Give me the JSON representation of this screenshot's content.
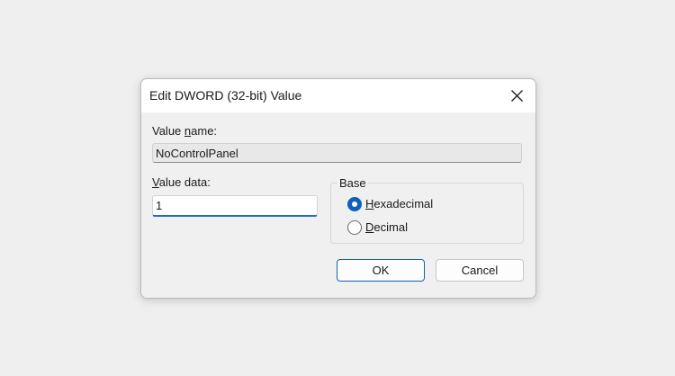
{
  "dialog": {
    "title": "Edit DWORD (32-bit) Value",
    "close_icon": "close-icon"
  },
  "value_name": {
    "label_pre": "Value ",
    "label_accel": "n",
    "label_post": "ame:",
    "value": "NoControlPanel"
  },
  "value_data": {
    "label_accel": "V",
    "label_post": "alue data:",
    "value": "1"
  },
  "base": {
    "legend": "Base",
    "options": [
      {
        "accel": "H",
        "rest": "exadecimal",
        "checked": true
      },
      {
        "accel": "D",
        "rest": "ecimal",
        "checked": false
      }
    ]
  },
  "buttons": {
    "ok": "OK",
    "cancel": "Cancel"
  },
  "colors": {
    "accent": "#0f5fbd",
    "background": "#efefef",
    "dialog_bg": "#f0f0f0"
  }
}
